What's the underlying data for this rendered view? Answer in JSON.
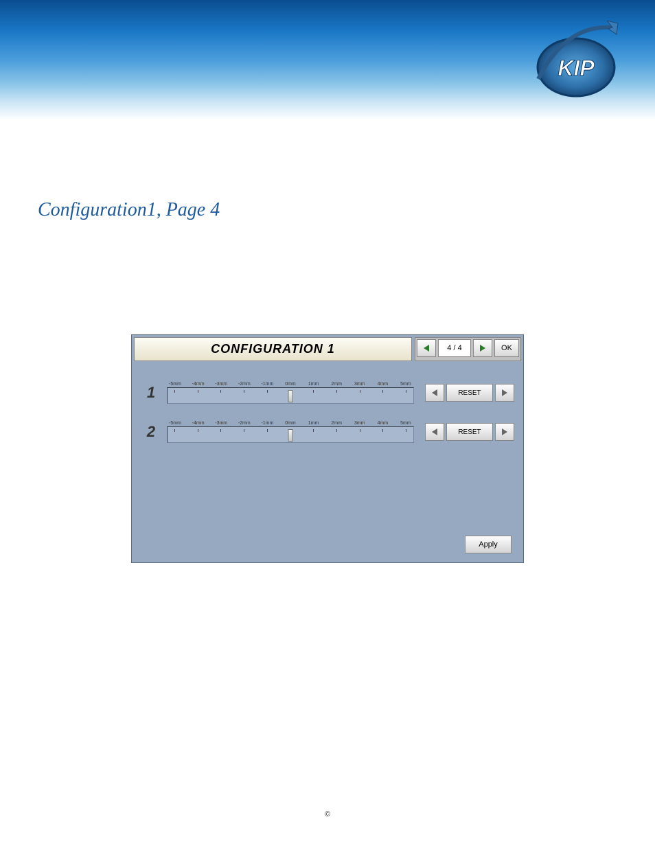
{
  "logo_text": "KIP",
  "page_title": "Configuration1, Page 4",
  "config": {
    "title": "CONFIGURATION 1",
    "page_indicator": "4 / 4",
    "ok_label": "OK",
    "apply_label": "Apply",
    "rows": [
      {
        "num": "1",
        "reset_label": "RESET",
        "ticks": [
          "-5mm",
          "-4mm",
          "-3mm",
          "-2mm",
          "-1mm",
          "0mm",
          "1mm",
          "2mm",
          "3mm",
          "4mm",
          "5mm"
        ]
      },
      {
        "num": "2",
        "reset_label": "RESET",
        "ticks": [
          "-5mm",
          "-4mm",
          "-3mm",
          "-2mm",
          "-1mm",
          "0mm",
          "1mm",
          "2mm",
          "3mm",
          "4mm",
          "5mm"
        ]
      }
    ]
  },
  "copyright": "©"
}
